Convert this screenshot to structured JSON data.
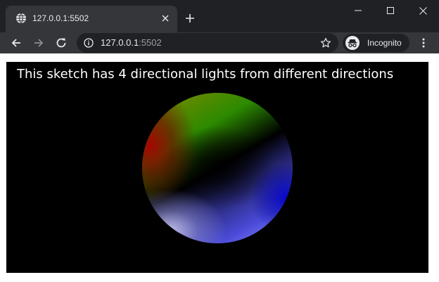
{
  "browser": {
    "tab": {
      "title": "127.0.0.1:5502",
      "favicon_icon": "globe-icon",
      "close_icon": "close-icon"
    },
    "new_tab_icon": "plus-icon",
    "window_controls": [
      "minimize-icon",
      "maximize-icon",
      "close-icon"
    ],
    "toolbar": {
      "back_icon": "arrow-left-icon",
      "forward_icon": "arrow-right-icon",
      "reload_icon": "reload-icon",
      "info_icon": "info-icon",
      "url_host": "127.0.0.1",
      "url_port": ":5502",
      "bookmark_icon": "star-icon",
      "profile_label": "Incognito",
      "menu_icon": "kebab-menu-icon"
    },
    "colors": {
      "frame": "#202124",
      "toolbar": "#35363a",
      "text": "#e8eaed",
      "text_dim": "#9aa0a6"
    }
  },
  "page": {
    "caption": "This sketch has 4 directional lights from different directions",
    "canvas_background": "#000000",
    "page_background": "#ffffff"
  }
}
